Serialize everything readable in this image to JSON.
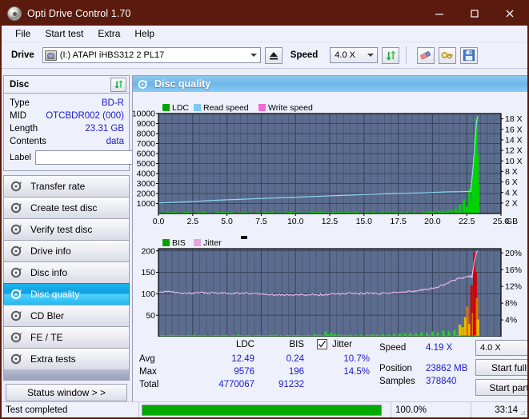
{
  "window": {
    "title": "Opti Drive Control 1.70",
    "icon": "disc-icon",
    "minimize": "minimize-button",
    "maximize": "maximize-button",
    "close": "close-button",
    "accent": "#5b1a0e"
  },
  "menu": {
    "items": [
      "File",
      "Start test",
      "Extra",
      "Help"
    ]
  },
  "toolbar": {
    "drive_label": "Drive",
    "drive_value": "(I:)  ATAPI iHBS312  2 PL17",
    "eject": "eject-button",
    "speed_label": "Speed",
    "speed_value": "4.0 X",
    "refresh": "refresh-button",
    "erase": "erase-button",
    "key": "key-button",
    "save": "save-button"
  },
  "disc": {
    "header": "Disc",
    "refresh": "refresh-disc-button",
    "rows": [
      {
        "name": "Type",
        "value": "BD-R"
      },
      {
        "name": "MID",
        "value": "OTCBDR002 (000)"
      },
      {
        "name": "Length",
        "value": "23.31 GB"
      },
      {
        "name": "Contents",
        "value": "data"
      }
    ],
    "label_name": "Label",
    "label_value": "",
    "label_placeholder": ""
  },
  "sidebar": {
    "items": [
      {
        "label": "Transfer rate",
        "active": false
      },
      {
        "label": "Create test disc",
        "active": false
      },
      {
        "label": "Verify test disc",
        "active": false
      },
      {
        "label": "Drive info",
        "active": false
      },
      {
        "label": "Disc info",
        "active": false
      },
      {
        "label": "Disc quality",
        "active": true
      },
      {
        "label": "CD Bler",
        "active": false
      },
      {
        "label": "FE / TE",
        "active": false
      },
      {
        "label": "Extra tests",
        "active": false
      }
    ],
    "status_window": "Status window > >"
  },
  "main": {
    "title": "Disc quality",
    "icon": "disc-quality-icon"
  },
  "stats": {
    "col_ldc": "LDC",
    "col_bis": "BIS",
    "jitter_label": "Jitter",
    "jitter_checked": true,
    "rows": [
      {
        "name": "Avg",
        "ldc": "12.49",
        "bis": "0.24",
        "jitter": "10.7%"
      },
      {
        "name": "Max",
        "ldc": "9576",
        "bis": "196",
        "jitter": "14.5%"
      },
      {
        "name": "Total",
        "ldc": "4770067",
        "bis": "91232",
        "jitter": ""
      }
    ],
    "speed_label": "Speed",
    "speed_value": "4.19 X",
    "speed_select": "4.0 X",
    "position_label": "Position",
    "position_value": "23862 MB",
    "samples_label": "Samples",
    "samples_value": "378840",
    "start_full": "Start full",
    "start_part": "Start part"
  },
  "statusbar": {
    "message": "Test completed",
    "percent_text": "100.0%",
    "percent_value": 100,
    "elapsed": "33:14",
    "bar_color": "#00a800"
  },
  "chart_data": [
    {
      "type": "area",
      "name": "top-chart",
      "title": "",
      "xlabel": "GB",
      "x_ticks": [
        "0.0",
        "2.5",
        "5.0",
        "7.5",
        "10.0",
        "12.5",
        "15.0",
        "17.5",
        "20.0",
        "22.5",
        "25.0"
      ],
      "xlim": [
        0,
        25
      ],
      "ylabel_left": "LDC",
      "y_ticks_left": [
        "1000",
        "2000",
        "3000",
        "4000",
        "5000",
        "6000",
        "7000",
        "8000",
        "9000",
        "10000"
      ],
      "ylim_left": [
        0,
        10000
      ],
      "ylabel_right": "Speed",
      "y_ticks_right": [
        "2 X",
        "4 X",
        "6 X",
        "8 X",
        "10 X",
        "12 X",
        "14 X",
        "16 X",
        "18 X"
      ],
      "ylim_right": [
        0,
        19
      ],
      "grid": true,
      "legend": [
        {
          "label": "LDC",
          "color": "#00a400"
        },
        {
          "label": "Read speed",
          "color": "#7ec8f2"
        },
        {
          "label": "Write speed",
          "color": "#f06ad0"
        }
      ],
      "plot_bg": "#5c6c8e",
      "series": [
        {
          "name": "LDC",
          "color": "#00d400",
          "kind": "bars",
          "x": [
            0.1,
            0.4,
            0.7,
            1.0,
            1.3,
            1.6,
            1.9,
            2.2,
            2.5,
            2.8,
            3.1,
            3.4,
            3.7,
            4.0,
            4.3,
            4.6,
            4.9,
            5.2,
            5.5,
            5.8,
            6.1,
            6.4,
            6.7,
            7.0,
            7.3,
            7.6,
            7.9,
            8.2,
            8.5,
            8.8,
            9.1,
            9.4,
            9.7,
            10.0,
            10.3,
            10.6,
            10.9,
            11.2,
            11.5,
            11.8,
            12.1,
            12.4,
            12.7,
            13.0,
            13.3,
            13.6,
            13.9,
            14.2,
            14.5,
            14.8,
            15.1,
            15.4,
            15.7,
            16.0,
            16.3,
            16.6,
            16.9,
            17.2,
            17.5,
            17.8,
            18.1,
            18.4,
            18.7,
            19.0,
            19.3,
            19.6,
            19.9,
            20.2,
            20.5,
            20.8,
            21.1,
            21.4,
            21.7,
            22.0,
            22.3,
            22.5,
            22.7,
            22.85,
            22.95,
            23.05,
            23.12,
            23.2,
            23.28,
            23.32
          ],
          "values": [
            120,
            90,
            80,
            70,
            75,
            65,
            70,
            60,
            65,
            80,
            70,
            60,
            65,
            70,
            60,
            65,
            70,
            60,
            65,
            70,
            60,
            65,
            140,
            70,
            65,
            60,
            160,
            70,
            65,
            60,
            70,
            65,
            140,
            70,
            60,
            65,
            70,
            180,
            65,
            60,
            170,
            70,
            65,
            180,
            70,
            65,
            60,
            70,
            190,
            65,
            60,
            70,
            160,
            65,
            60,
            70,
            180,
            65,
            60,
            70,
            160,
            65,
            190,
            70,
            65,
            200,
            220,
            180,
            260,
            210,
            300,
            350,
            420,
            900,
            1400,
            700,
            2500,
            1200,
            4200,
            5600,
            7600,
            9576,
            6000,
            3000
          ]
        },
        {
          "name": "Read speed",
          "color": "#8ed8f8",
          "kind": "line",
          "x": [
            0.0,
            1.0,
            2.0,
            3.0,
            4.0,
            5.0,
            6.0,
            7.0,
            8.0,
            9.0,
            10.0,
            11.0,
            12.0,
            13.0,
            14.0,
            15.0,
            16.0,
            17.0,
            18.0,
            19.0,
            20.0,
            21.0,
            22.0,
            22.8,
            23.0,
            23.2,
            23.3
          ],
          "values": [
            2.0,
            2.1,
            2.2,
            2.35,
            2.5,
            2.6,
            2.7,
            2.8,
            2.9,
            3.0,
            3.1,
            3.2,
            3.3,
            3.4,
            3.5,
            3.6,
            3.7,
            3.8,
            3.85,
            3.9,
            4.0,
            4.1,
            4.15,
            4.2,
            10.0,
            17.0,
            18.5
          ]
        }
      ]
    },
    {
      "type": "area",
      "name": "bottom-chart",
      "title": "",
      "xlabel": "GB",
      "x_ticks": [
        "0.0",
        "2.5",
        "5.0",
        "7.5",
        "10.0",
        "12.5",
        "15.0",
        "17.5",
        "20.0",
        "22.5",
        "25.0"
      ],
      "xlim": [
        0,
        25
      ],
      "ylabel_left": "BIS",
      "y_ticks_left": [
        "50",
        "100",
        "150",
        "200"
      ],
      "ylim_left": [
        0,
        205
      ],
      "ylabel_right": "Jitter",
      "y_ticks_right": [
        "4%",
        "8%",
        "12%",
        "16%",
        "20%"
      ],
      "ylim_right": [
        0,
        21
      ],
      "grid": true,
      "legend": [
        {
          "label": "BIS",
          "color": "#00a400"
        },
        {
          "label": "Jitter",
          "color": "#e0a8e0"
        }
      ],
      "plot_bg": "#5c6c8e",
      "series": [
        {
          "name": "BIS",
          "color": "#00d400",
          "kind": "bars",
          "x": [
            0.2,
            0.6,
            1.0,
            1.4,
            1.8,
            2.2,
            2.6,
            3.0,
            3.4,
            3.8,
            4.2,
            4.6,
            5.0,
            5.4,
            5.8,
            6.2,
            6.6,
            7.0,
            7.4,
            7.8,
            8.2,
            8.6,
            9.0,
            9.4,
            9.8,
            10.2,
            10.6,
            11.0,
            11.4,
            11.8,
            12.2,
            12.4,
            12.6,
            12.9,
            13.2,
            13.6,
            14.0,
            14.4,
            14.8,
            15.2,
            15.6,
            16.0,
            16.4,
            16.8,
            17.2,
            17.6,
            18.0,
            18.4,
            18.8,
            19.2,
            19.6,
            20.0,
            20.4,
            20.8,
            21.2,
            21.6,
            22.0,
            22.2,
            22.4,
            22.55,
            22.7,
            22.85,
            22.95,
            23.05,
            23.15,
            23.25,
            23.32
          ],
          "values": [
            4,
            3,
            4,
            3,
            4,
            3,
            5,
            3,
            4,
            3,
            4,
            3,
            4,
            3,
            5,
            3,
            4,
            3,
            4,
            3,
            4,
            5,
            3,
            4,
            3,
            4,
            3,
            4,
            6,
            4,
            12,
            5,
            9,
            6,
            5,
            4,
            5,
            4,
            5,
            4,
            5,
            4,
            6,
            5,
            6,
            7,
            8,
            9,
            8,
            10,
            9,
            12,
            10,
            14,
            12,
            16,
            28,
            22,
            45,
            70,
            30,
            120,
            55,
            196,
            150,
            90,
            40
          ]
        },
        {
          "name": "Jitter",
          "color": "#e6b4e6",
          "kind": "line",
          "x": [
            0.0,
            0.5,
            1.0,
            1.5,
            2.0,
            2.5,
            3.0,
            3.5,
            4.0,
            4.5,
            5.0,
            5.5,
            6.0,
            6.5,
            7.0,
            7.5,
            8.0,
            8.5,
            9.0,
            9.5,
            10.0,
            10.5,
            11.0,
            11.5,
            12.0,
            12.5,
            13.0,
            13.5,
            14.0,
            14.5,
            15.0,
            15.5,
            16.0,
            16.5,
            17.0,
            17.5,
            18.0,
            18.5,
            19.0,
            19.5,
            20.0,
            20.5,
            21.0,
            21.5,
            22.0,
            22.4,
            22.7,
            22.9,
            23.05,
            23.2,
            23.3
          ],
          "values": [
            10.8,
            10.7,
            10.6,
            10.5,
            10.3,
            10.4,
            10.5,
            10.4,
            10.5,
            10.4,
            10.3,
            10.4,
            10.3,
            10.4,
            10.3,
            10.2,
            10.0,
            9.9,
            10.0,
            9.9,
            10.0,
            10.1,
            10.0,
            10.1,
            10.0,
            10.1,
            10.2,
            10.3,
            10.4,
            10.3,
            10.3,
            10.4,
            10.3,
            10.4,
            10.5,
            10.6,
            10.7,
            10.8,
            11.0,
            11.2,
            11.5,
            12.0,
            12.6,
            13.4,
            14.0,
            14.2,
            14.5,
            14.3,
            18.0,
            20.0,
            20.5
          ]
        }
      ]
    }
  ]
}
